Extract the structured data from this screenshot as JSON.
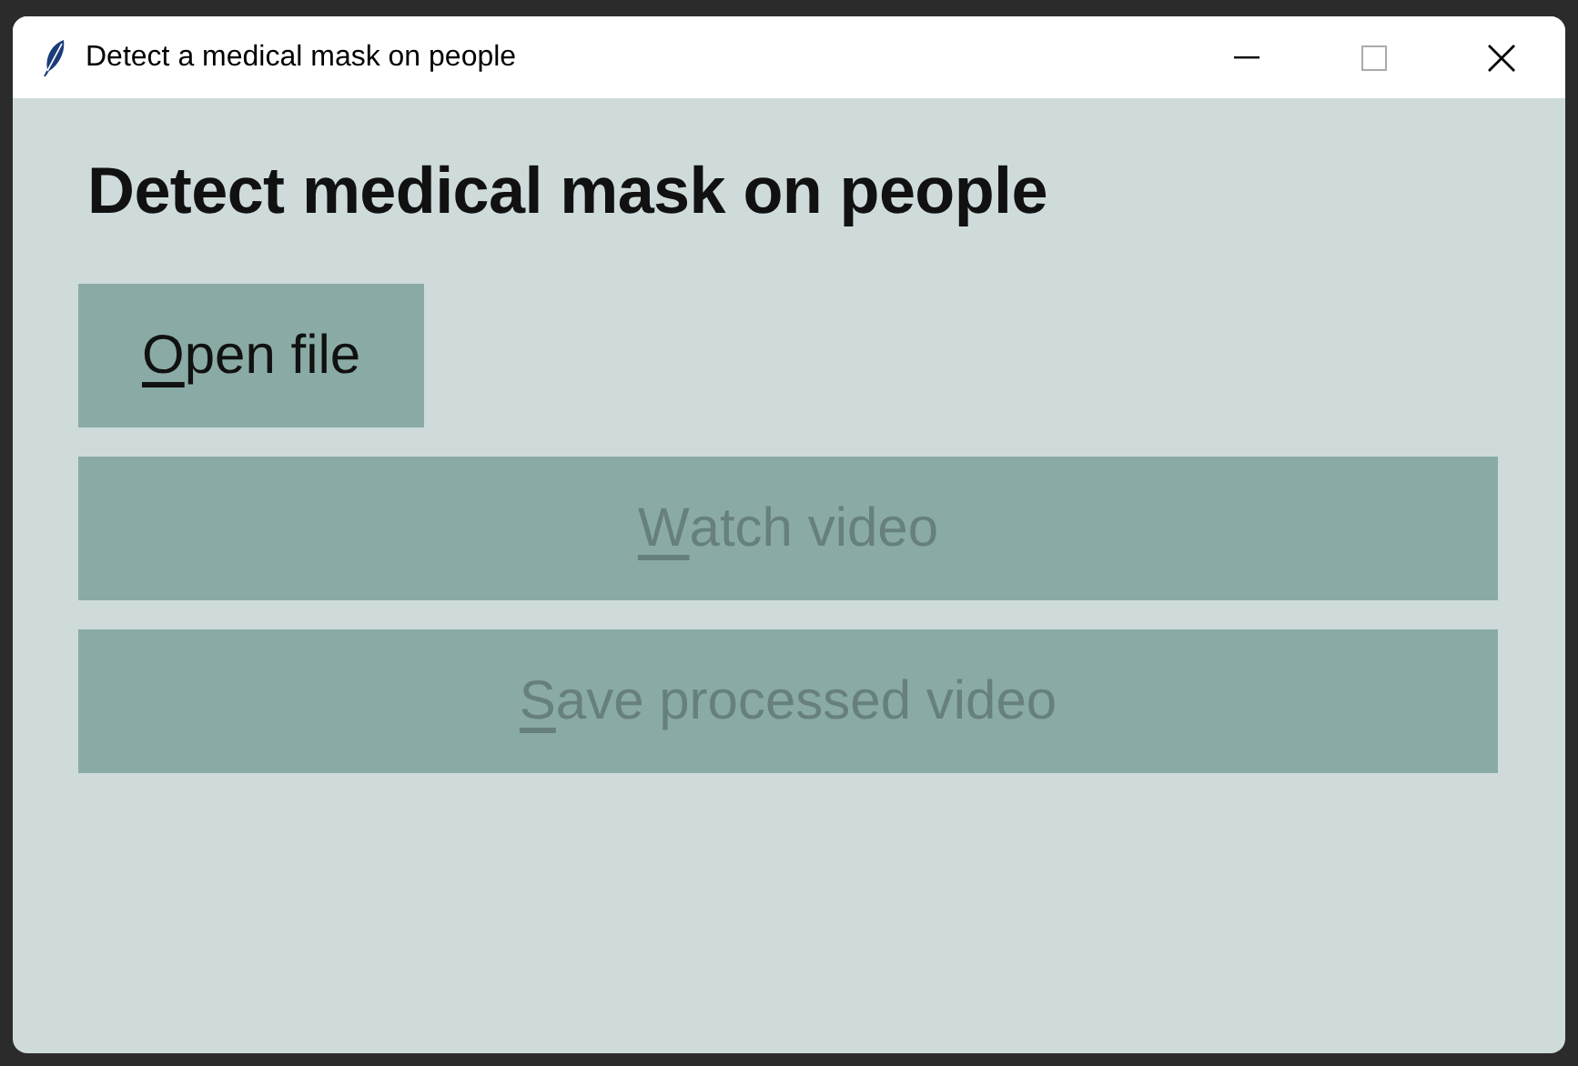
{
  "window": {
    "title": "Detect a medical mask on people"
  },
  "heading": "Detect medical mask on people",
  "buttons": [
    {
      "label": "Open file",
      "mnemonic_underlined": true,
      "disabled": false,
      "wide": false
    },
    {
      "label": "Watch video",
      "mnemonic_underlined": true,
      "disabled": true,
      "wide": true
    },
    {
      "label": "Save processed video",
      "mnemonic_underlined": true,
      "disabled": true,
      "wide": true
    }
  ]
}
